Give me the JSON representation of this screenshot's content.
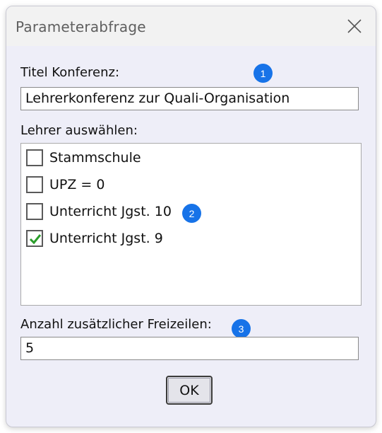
{
  "window": {
    "title": "Parameterabfrage",
    "close_icon": "close-icon"
  },
  "form": {
    "title_label": "Titel Konferenz:",
    "title_value": "Lehrerkonferenz zur Quali-Organisation",
    "teachers_label": "Lehrer auswählen:",
    "teacher_options": [
      {
        "label": "Stammschule",
        "checked": false
      },
      {
        "label": "UPZ = 0",
        "checked": false
      },
      {
        "label": "Unterricht Jgst. 10",
        "checked": false
      },
      {
        "label": "Unterricht Jgst. 9",
        "checked": true
      }
    ],
    "extra_rows_label": "Anzahl zusätzlicher Freizeilen:",
    "extra_rows_value": "5",
    "ok_label": "OK"
  },
  "badges": [
    "1",
    "2",
    "3"
  ],
  "colors": {
    "badge": "#1773e8",
    "checkmark": "#2a9d2a",
    "dialog_bg": "#eeeef8",
    "titlebar_bg": "#f2f2f2"
  }
}
